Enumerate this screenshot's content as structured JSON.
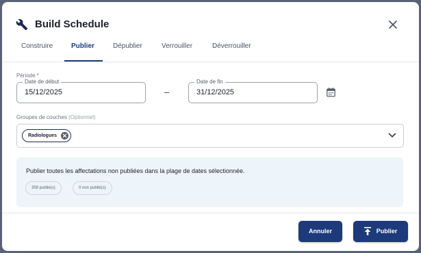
{
  "dialog": {
    "title": "Build Schedule",
    "title_icon": "wrench-icon",
    "close_icon": "close-icon"
  },
  "tabs": [
    {
      "label": "Construire",
      "active": false
    },
    {
      "label": "Publier",
      "active": true
    },
    {
      "label": "Dépublier",
      "active": false
    },
    {
      "label": "Verrouiller",
      "active": false
    },
    {
      "label": "Déverrouiller",
      "active": false
    }
  ],
  "period": {
    "label": "Période *",
    "start": {
      "legend": "Date de début",
      "value": "15/12/2025"
    },
    "separator": "–",
    "end": {
      "legend": "Date de fin",
      "value": "31/12/2025"
    },
    "calendar_icon": "calendar-icon"
  },
  "groups": {
    "label": "Groupes de couches",
    "optional": "(Optionnel)",
    "chips": [
      "Radiologues"
    ],
    "dropdown_icon": "chevron-down-icon"
  },
  "info": {
    "text": "Publier toutes les affectations non publiées dans la plage de dates sélectionnée.",
    "published": "358 publié(s)",
    "unpublished": "0 non publié(s)"
  },
  "footer": {
    "cancel_label": "Annuler",
    "publish_label": "Publier",
    "publish_icon": "upload-icon"
  },
  "colors": {
    "primary": "#1d3a7a",
    "info_background": "#eef5fa"
  }
}
